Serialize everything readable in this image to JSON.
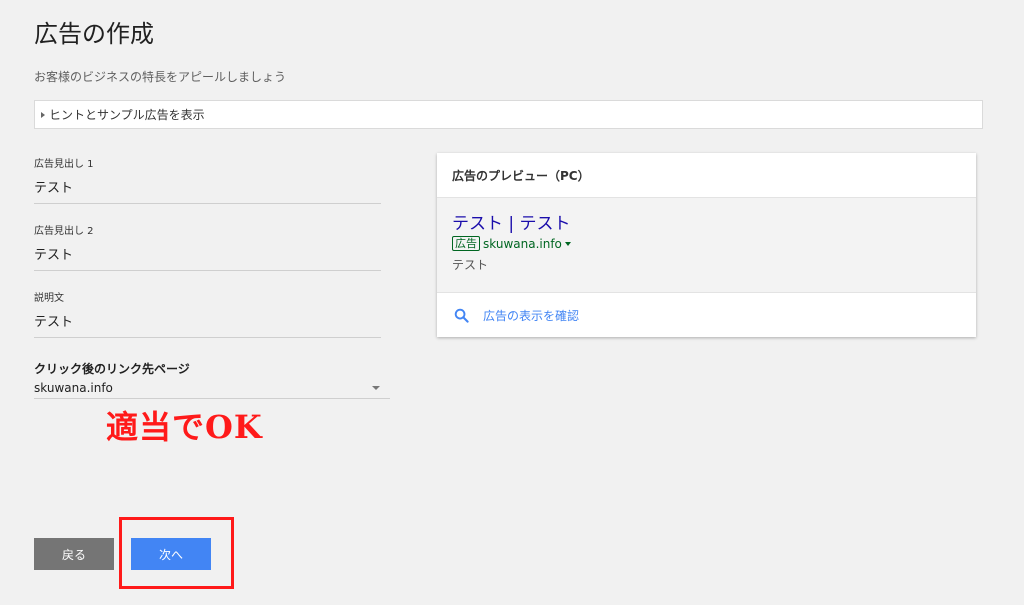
{
  "page": {
    "title": "広告の作成",
    "subtitle": "お客様のビジネスの特長をアピールしましょう",
    "hints_label": "ヒントとサンプル広告を表示"
  },
  "form": {
    "headline1": {
      "label": "広告見出し 1",
      "value": "テスト"
    },
    "headline2": {
      "label": "広告見出し 2",
      "value": "テスト"
    },
    "description": {
      "label": "説明文",
      "value": "テスト"
    },
    "final_url": {
      "label": "クリック後のリンク先ページ",
      "value": "skuwana.info"
    }
  },
  "annotation": "適当でOK",
  "preview": {
    "title": "広告のプレビュー（PC）",
    "headline": "テスト | テスト",
    "ad_badge": "広告",
    "display_url": "skuwana.info",
    "description": "テスト",
    "check_label": "広告の表示を確認"
  },
  "buttons": {
    "back_label": "戻る",
    "next_label": "次へ"
  },
  "colors": {
    "accent": "#4285f4",
    "annotation": "#ff1a1a",
    "ad_green": "#006621",
    "headline_blue": "#1a0dab"
  }
}
